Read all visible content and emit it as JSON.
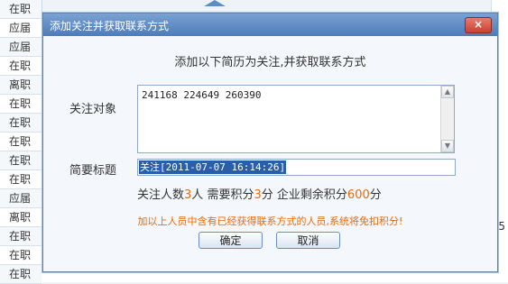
{
  "background": {
    "row_status": [
      "在职",
      "应届",
      "应届",
      "在职",
      "离职",
      "在职",
      "在职",
      "在职",
      "在职",
      "在职",
      "应届",
      "离职",
      "在职",
      "在职",
      "在职"
    ],
    "right_edge_text": "5"
  },
  "dialog": {
    "title": "添加关注并获取联系方式",
    "close_symbol": "×",
    "heading": "添加以下简历为关注,并获取联系方式",
    "target_label": "关注对象",
    "target_value": "241168 224649 260390",
    "summary_label": "简要标题",
    "summary_value": "关注[2011-07-07 16:14:26]",
    "stats": {
      "count_label": "关注人数",
      "count": "3",
      "count_unit": "人",
      "need_label": "需要积分",
      "need": "3",
      "need_unit": "分",
      "remain_label": "企业剩余积分",
      "remain": "600",
      "remain_unit": "分"
    },
    "warning": "加以上人员中含有已经获得联系方式的人员,系统将免扣积分!",
    "ok_label": "确定",
    "cancel_label": "取消"
  },
  "colors": {
    "titlebar": "#4d7cba",
    "accent_orange": "#e46c0a",
    "selection": "#2a5ea8"
  }
}
